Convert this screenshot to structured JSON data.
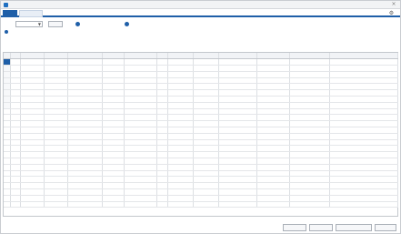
{
  "window": {
    "title": ""
  },
  "tabs": [
    {
      "label": ""
    },
    {
      "label": ""
    }
  ],
  "header": {
    "settings_label": ""
  },
  "filter": {
    "year_label": "",
    "year_value": "",
    "search_button": "",
    "option1_label": "",
    "option2_label": ""
  },
  "notice": {
    "lines": [
      "",
      ""
    ]
  },
  "table": {
    "columns": [
      "",
      "",
      "",
      "",
      "",
      "",
      "",
      "",
      "",
      "",
      "",
      "",
      "",
      ""
    ],
    "rows": [
      {
        "cells": [
          "",
          "",
          "",
          "",
          "",
          "",
          "",
          "",
          "",
          "",
          "",
          "",
          "",
          ""
        ]
      },
      {
        "cells": [
          "",
          "",
          "",
          "",
          "",
          "",
          "",
          "",
          "",
          "",
          "",
          "",
          "",
          ""
        ]
      },
      {
        "cells": [
          "",
          "",
          "",
          "",
          "",
          "",
          "",
          "",
          "",
          "",
          "",
          "",
          "",
          ""
        ]
      },
      {
        "cells": [
          "",
          "",
          "",
          "",
          "",
          "",
          "",
          "",
          "",
          "",
          "",
          "",
          "",
          ""
        ]
      },
      {
        "cells": [
          "",
          "",
          "",
          "",
          "",
          "",
          "",
          "",
          "",
          "",
          "",
          "",
          "",
          ""
        ]
      },
      {
        "cells": [
          "",
          "",
          "",
          "",
          "",
          "",
          "",
          "",
          "",
          "",
          "",
          "",
          "",
          ""
        ]
      },
      {
        "cells": [
          "",
          "",
          "",
          "",
          "",
          "",
          "",
          "",
          "",
          "",
          "",
          "",
          "",
          ""
        ]
      },
      {
        "cells": [
          "",
          "",
          "",
          "",
          "",
          "",
          "",
          "",
          "",
          "",
          "",
          "",
          "",
          ""
        ]
      }
    ]
  },
  "status": {
    "count": ""
  },
  "buttons": [
    "",
    "",
    "",
    ""
  ],
  "colors": {
    "accent": "#1f5fa8",
    "header_bg": "#f1f3f6"
  }
}
